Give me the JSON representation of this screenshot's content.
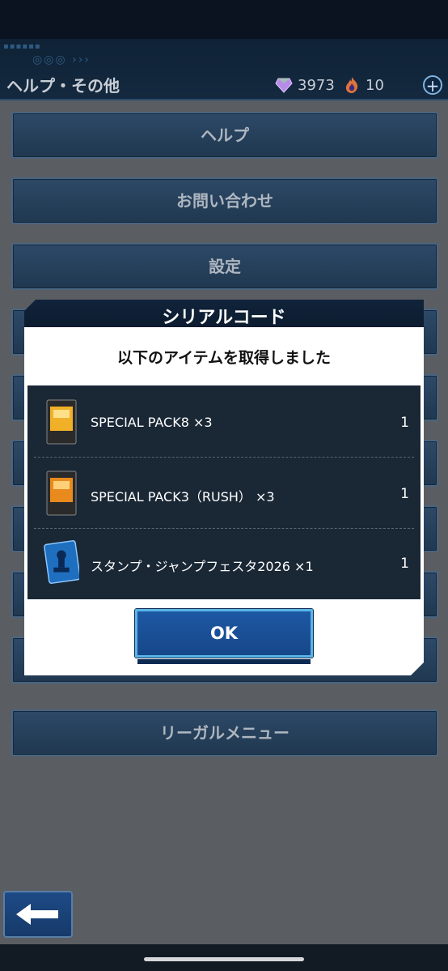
{
  "header": {
    "title": "ヘルプ・その他",
    "gems": "3973",
    "flames": "10",
    "plus": "+"
  },
  "menu": {
    "items": [
      {
        "label": "ヘルプ"
      },
      {
        "label": "お問い合わせ"
      },
      {
        "label": "設定"
      },
      {
        "label": "リーガルメニュー"
      }
    ]
  },
  "dialog": {
    "title": "シリアルコード",
    "subtitle": "以下のアイテムを取得しました",
    "items": [
      {
        "name": "SPECIAL PACK8 ×3",
        "qty": "1",
        "icon": "pack-icon"
      },
      {
        "name": "SPECIAL PACK3（RUSH） ×3",
        "qty": "1",
        "icon": "pack-icon"
      },
      {
        "name": "スタンプ・ジャンプフェスタ2026 ×1",
        "qty": "1",
        "icon": "stamp-icon"
      }
    ],
    "ok_label": "OK"
  },
  "colors": {
    "header_bg": "#0f2236",
    "menu_button": "#2d4967",
    "ok_button": "#1d58a3",
    "ok_border": "#5ab4e6"
  }
}
